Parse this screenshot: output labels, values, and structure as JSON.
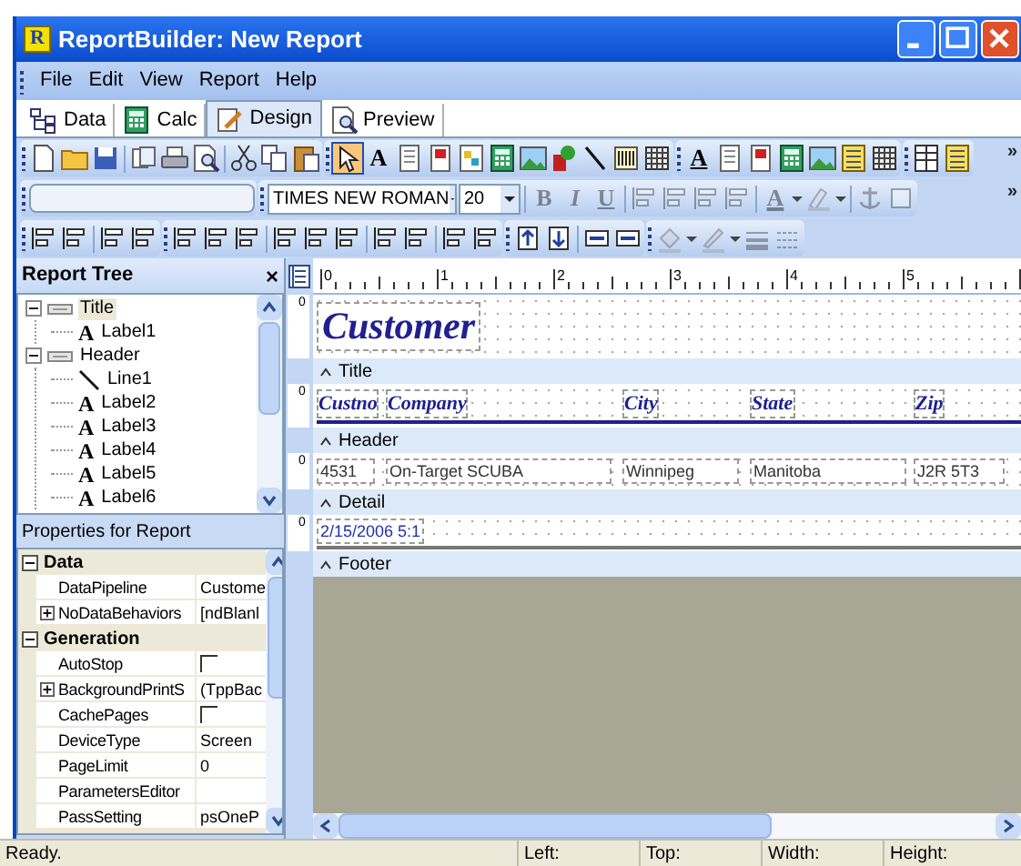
{
  "window": {
    "app_icon": "R",
    "title": "ReportBuilder: New Report"
  },
  "menu": [
    "File",
    "Edit",
    "View",
    "Report",
    "Help"
  ],
  "tabs": [
    {
      "label": "Data",
      "selected": false
    },
    {
      "label": "Calc",
      "selected": false
    },
    {
      "label": "Design",
      "selected": true
    },
    {
      "label": "Preview",
      "selected": false
    }
  ],
  "toolbars": [
    {
      "overflow": "»",
      "groups": [
        [
          {
            "kind": "icon",
            "disabled": false
          },
          {
            "kind": "icon",
            "disabled": false
          },
          {
            "kind": "icon",
            "disabled": false
          },
          {
            "kind": "separator"
          },
          {
            "kind": "icon",
            "disabled": false
          },
          {
            "kind": "icon",
            "disabled": false
          },
          {
            "kind": "icon",
            "disabled": false
          },
          {
            "kind": "separator"
          },
          {
            "kind": "icon",
            "disabled": false
          },
          {
            "kind": "icon",
            "disabled": false
          },
          {
            "kind": "icon",
            "disabled": false
          }
        ],
        [
          {
            "kind": "icon",
            "disabled": false,
            "selected": true
          },
          {
            "kind": "text",
            "label": "A",
            "disabled": false,
            "selected": false
          },
          {
            "kind": "icon",
            "disabled": false,
            "selected": false
          },
          {
            "kind": "icon",
            "disabled": false,
            "selected": false
          },
          {
            "kind": "icon",
            "disabled": false,
            "selected": false
          },
          {
            "kind": "icon",
            "disabled": false,
            "selected": false
          },
          {
            "kind": "icon",
            "disabled": false,
            "selected": false
          },
          {
            "kind": "icon",
            "disabled": false,
            "selected": false
          },
          {
            "kind": "icon",
            "disabled": false,
            "selected": false
          },
          {
            "kind": "icon",
            "disabled": false,
            "selected": false
          },
          {
            "kind": "icon",
            "disabled": false,
            "selected": false
          }
        ],
        [
          {
            "kind": "text",
            "label": "A",
            "disabled": false
          },
          {
            "kind": "icon",
            "disabled": false
          },
          {
            "kind": "icon",
            "disabled": false
          },
          {
            "kind": "icon",
            "disabled": false
          },
          {
            "kind": "icon",
            "disabled": false
          },
          {
            "kind": "icon",
            "disabled": false
          },
          {
            "kind": "icon",
            "disabled": false
          }
        ],
        [
          {
            "kind": "icon",
            "disabled": false
          },
          {
            "kind": "icon",
            "disabled": false
          }
        ]
      ]
    },
    {
      "overflow": "»",
      "groups": [
        [
          {
            "kind": "field"
          }
        ],
        [
          {
            "kind": "combo",
            "value": "TIMES NEW ROMAN"
          },
          {
            "kind": "combo",
            "value": "20"
          },
          {
            "kind": "separator"
          },
          {
            "kind": "text",
            "label": "B",
            "disabled": true
          },
          {
            "kind": "text",
            "label": "I",
            "disabled": true
          },
          {
            "kind": "text",
            "label": "U",
            "disabled": true
          },
          {
            "kind": "separator"
          },
          {
            "kind": "icon",
            "disabled": true
          },
          {
            "kind": "icon",
            "disabled": true
          },
          {
            "kind": "icon",
            "disabled": true
          },
          {
            "kind": "icon",
            "disabled": true
          },
          {
            "kind": "separator"
          },
          {
            "kind": "text",
            "label": "A",
            "disabled": true,
            "dropdown": true
          },
          {
            "kind": "icon",
            "disabled": true,
            "dropdown": true
          },
          {
            "kind": "separator"
          },
          {
            "kind": "icon",
            "disabled": true
          },
          {
            "kind": "icon",
            "disabled": true
          }
        ]
      ]
    },
    {
      "groups": [
        [
          {
            "kind": "icon",
            "disabled": false
          },
          {
            "kind": "icon",
            "disabled": false
          },
          {
            "kind": "separator"
          },
          {
            "kind": "icon",
            "disabled": false
          },
          {
            "kind": "icon",
            "disabled": false
          }
        ],
        [
          {
            "kind": "icon",
            "disabled": false
          },
          {
            "kind": "icon",
            "disabled": false
          },
          {
            "kind": "icon",
            "disabled": false
          },
          {
            "kind": "separator"
          },
          {
            "kind": "icon",
            "disabled": false
          },
          {
            "kind": "icon",
            "disabled": false
          },
          {
            "kind": "icon",
            "disabled": false
          },
          {
            "kind": "separator"
          },
          {
            "kind": "icon",
            "disabled": false
          },
          {
            "kind": "icon",
            "disabled": false
          },
          {
            "kind": "separator"
          },
          {
            "kind": "icon",
            "disabled": false
          },
          {
            "kind": "icon",
            "disabled": false
          }
        ],
        [
          {
            "kind": "icon",
            "disabled": false
          },
          {
            "kind": "icon",
            "disabled": false
          },
          {
            "kind": "separator"
          },
          {
            "kind": "icon",
            "disabled": false
          },
          {
            "kind": "icon",
            "disabled": false
          }
        ],
        [
          {
            "kind": "icon",
            "disabled": true,
            "dropdown": true
          },
          {
            "kind": "icon",
            "disabled": true,
            "dropdown": true
          },
          {
            "kind": "icon",
            "disabled": true
          },
          {
            "kind": "icon",
            "disabled": true
          }
        ]
      ]
    }
  ],
  "report_tree": {
    "title": "Report Tree",
    "close": "×",
    "nodes": [
      {
        "kind": "band",
        "label": "Title",
        "expanded": true,
        "selected": true,
        "children": [
          {
            "kind": "label",
            "glyph": "A",
            "label": "Label1",
            "selected": false
          }
        ]
      },
      {
        "kind": "band",
        "label": "Header",
        "expanded": true,
        "selected": false,
        "children": [
          {
            "kind": "line",
            "label": "Line1",
            "selected": false
          },
          {
            "kind": "label",
            "glyph": "A",
            "label": "Label2",
            "selected": false
          },
          {
            "kind": "label",
            "glyph": "A",
            "label": "Label3",
            "selected": false
          },
          {
            "kind": "label",
            "glyph": "A",
            "label": "Label4",
            "selected": false
          },
          {
            "kind": "label",
            "glyph": "A",
            "label": "Label5",
            "selected": false
          },
          {
            "kind": "label",
            "glyph": "A",
            "label": "Label6",
            "selected": false
          }
        ]
      }
    ]
  },
  "properties": {
    "title": "Properties for Report",
    "categories": [
      {
        "name": "Data",
        "expanded": true,
        "properties": [
          {
            "name": "DataPipeline",
            "kind": "text",
            "value": "Custome",
            "expandable": false
          },
          {
            "name": "NoDataBehaviors",
            "kind": "text",
            "value": "[ndBlanl",
            "expandable": true
          }
        ]
      },
      {
        "name": "Generation",
        "expanded": true,
        "properties": [
          {
            "name": "AutoStop",
            "kind": "checkbox",
            "checked": false,
            "expandable": false
          },
          {
            "name": "BackgroundPrintS",
            "kind": "text",
            "value": "(TppBac",
            "expandable": true
          },
          {
            "name": "CachePages",
            "kind": "checkbox",
            "checked": false,
            "expandable": false
          },
          {
            "name": "DeviceType",
            "kind": "text",
            "value": "Screen",
            "expandable": false
          },
          {
            "name": "PageLimit",
            "kind": "text",
            "value": "0",
            "expandable": false
          },
          {
            "name": "ParametersEditor",
            "kind": "text",
            "expandable": false
          },
          {
            "name": "PassSetting",
            "kind": "text",
            "value": "psOneP",
            "expandable": false
          }
        ]
      }
    ]
  },
  "ruler": {
    "labels": [
      "0",
      "1",
      "2",
      "3",
      "4",
      "5"
    ]
  },
  "bands": [
    {
      "kind": "title",
      "label": "Title",
      "ruler_mark": "0",
      "items": [
        "Customer"
      ]
    },
    {
      "kind": "header",
      "label": "Header",
      "ruler_mark": "0",
      "items": [
        "Custno",
        "Company",
        "City",
        "State",
        "Zip"
      ]
    },
    {
      "kind": "detail",
      "label": "Detail",
      "ruler_mark": "0",
      "items": [
        "4531",
        "On-Target SCUBA",
        "Winnipeg",
        "Manitoba",
        "J2R 5T3"
      ]
    },
    {
      "kind": "footer",
      "label": "Footer",
      "ruler_mark": "0",
      "items": [
        "2/15/2006 5:1"
      ]
    }
  ],
  "status_bar": [
    "Ready.",
    "Left:",
    "Top:",
    "Width:",
    "Height:"
  ]
}
